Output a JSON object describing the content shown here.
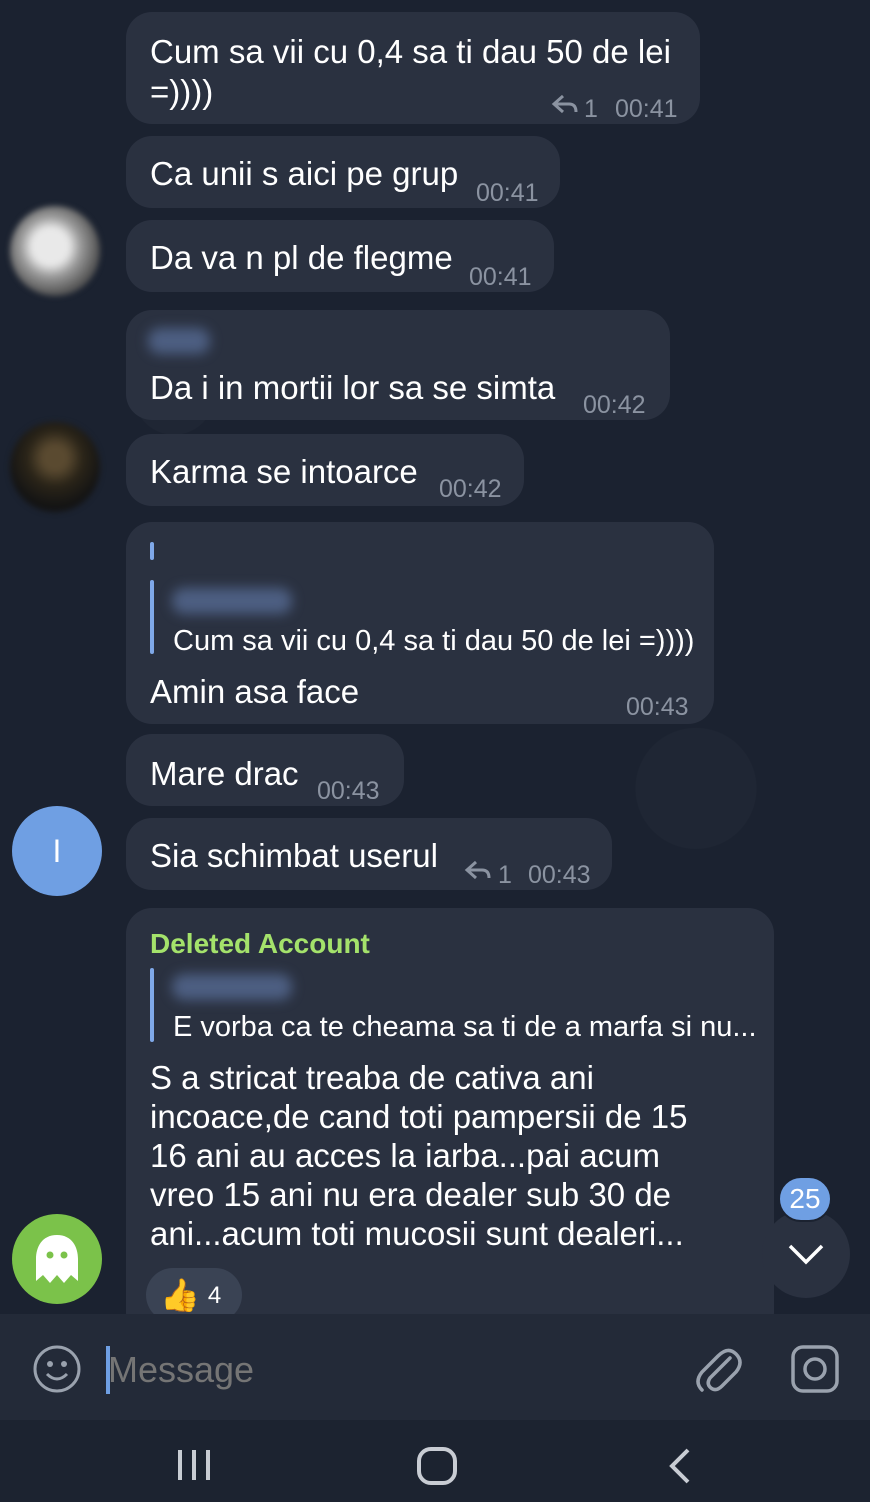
{
  "messages": [
    {
      "text_line1": "Cum sa vii cu 0,4 sa ti dau 50 de lei",
      "text_line2": "=))))",
      "replies": "1",
      "time": "00:41"
    },
    {
      "text": "Ca unii s aici pe grup",
      "time": "00:41"
    },
    {
      "text": "Da va n pl de flegme",
      "time": "00:41"
    },
    {
      "text": "Da i in mortii lor sa se simta",
      "time": "00:42"
    },
    {
      "text": "Karma se intoarce",
      "time": "00:42"
    },
    {
      "quote": "Cum sa vii cu 0,4 sa ti dau 50 de lei =))))",
      "text": "Amin asa face",
      "time": "00:43"
    },
    {
      "text": "Mare drac",
      "time": "00:43"
    },
    {
      "text": "Sia schimbat userul",
      "replies": "1",
      "time": "00:43"
    },
    {
      "sender": "Deleted Account",
      "quote": "E vorba ca te cheama sa ti de a marfa si nu...",
      "lines": [
        "S a stricat treaba de cativa ani",
        "incoace,de cand toti pampersii de 15",
        "16 ani au acces la iarba...pai acum",
        "vreo 15 ani nu era dealer sub 30 de",
        "ani...acum toti mucosii sunt dealeri..."
      ],
      "reaction_emoji": "👍",
      "reaction_count": "4"
    }
  ],
  "avatar_letter": "I",
  "scroll_badge": "25",
  "composer": {
    "placeholder": "Message"
  },
  "icons": [
    "emoji-icon",
    "attach-icon",
    "camera-icon",
    "recent-apps-icon",
    "home-icon",
    "back-icon",
    "reply-icon",
    "ghost-icon",
    "scroll-down-icon"
  ],
  "colors": {
    "background": "#1b2230",
    "bubble": "#2a3140",
    "sender": "#a4e26b",
    "badge": "#6f9fe3",
    "avatar_i": "#6f9fe3",
    "avatar_ghost": "#7bc24a"
  }
}
